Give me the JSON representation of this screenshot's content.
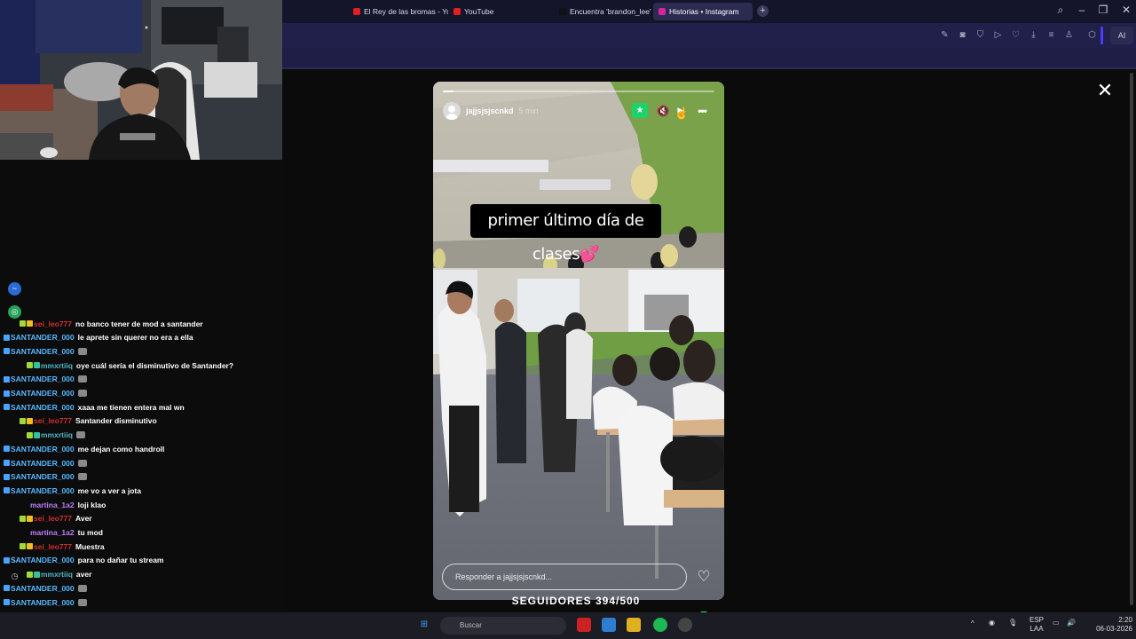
{
  "browser": {
    "tabs": [
      {
        "label": "El Rey de las bromas - Yo",
        "fav": "#e02020",
        "active": false
      },
      {
        "label": "YouTube",
        "fav": "#e02020",
        "active": false
      },
      {
        "label": "Encuentra 'brandon_lee' e",
        "fav": "#111111",
        "active": false
      },
      {
        "label": "Historias • Instagram",
        "fav": "#d6249f",
        "active": true
      }
    ],
    "new_tab_label": "+",
    "ai_label": "AI"
  },
  "story": {
    "username": "jajjsjsjscnkd",
    "time": "5 min",
    "caption": "primer último día de clases💕",
    "reply_placeholder": "Responder a jajjsjsjscnkd...",
    "progress": 0.04
  },
  "chat": {
    "messages": [
      {
        "user": "sei_leo777",
        "color": "#d0312d",
        "badges": [
          "#a2d93a",
          "#f0c020"
        ],
        "text": "no banco tener de mod a santander",
        "emote": false
      },
      {
        "user": "SANTANDER_000",
        "color": "#57b8ff",
        "badges": [
          "#4aa3ff"
        ],
        "text": "le aprete sin querer no era a ella",
        "emote": false
      },
      {
        "user": "SANTANDER_000",
        "color": "#57b8ff",
        "badges": [
          "#4aa3ff"
        ],
        "text": "",
        "emote": true
      },
      {
        "user": "mmxrtiiq",
        "color": "#4fb7c6",
        "badges": [
          "#a2d93a",
          "#35c0a0"
        ],
        "text": "oye cuál sería el disminutivo de Santander?",
        "emote": false
      },
      {
        "user": "SANTANDER_000",
        "color": "#57b8ff",
        "badges": [
          "#4aa3ff"
        ],
        "text": "",
        "emote": true
      },
      {
        "user": "SANTANDER_000",
        "color": "#57b8ff",
        "badges": [
          "#4aa3ff"
        ],
        "text": "",
        "emote": true
      },
      {
        "user": "SANTANDER_000",
        "color": "#57b8ff",
        "badges": [
          "#4aa3ff"
        ],
        "text": "xaaa me tienen entera mal wn",
        "emote": false
      },
      {
        "user": "sei_leo777",
        "color": "#d0312d",
        "badges": [
          "#a2d93a",
          "#f0c020"
        ],
        "text": "Santander disminutivo",
        "emote": false
      },
      {
        "user": "mmxrtiiq",
        "color": "#4fb7c6",
        "badges": [
          "#a2d93a",
          "#35c0a0"
        ],
        "text": "",
        "emote": true
      },
      {
        "user": "SANTANDER_000",
        "color": "#57b8ff",
        "badges": [
          "#4aa3ff"
        ],
        "text": "me dejan como handroll",
        "emote": false
      },
      {
        "user": "SANTANDER_000",
        "color": "#57b8ff",
        "badges": [
          "#4aa3ff"
        ],
        "text": "",
        "emote": true
      },
      {
        "user": "SANTANDER_000",
        "color": "#57b8ff",
        "badges": [
          "#4aa3ff"
        ],
        "text": "",
        "emote": true
      },
      {
        "user": "SANTANDER_000",
        "color": "#57b8ff",
        "badges": [
          "#4aa3ff"
        ],
        "text": "me vo a ver a jota",
        "emote": false
      },
      {
        "user": "martina_1a2",
        "color": "#c07dff",
        "badges": [],
        "text": "loji klao",
        "emote": false
      },
      {
        "user": "sei_leo777",
        "color": "#d0312d",
        "badges": [
          "#a2d93a",
          "#f0c020"
        ],
        "text": "Aver",
        "emote": false
      },
      {
        "user": "martina_1a2",
        "color": "#c07dff",
        "badges": [],
        "text": "tu mod",
        "emote": false
      },
      {
        "user": "sei_leo777",
        "color": "#d0312d",
        "badges": [
          "#a2d93a",
          "#f0c020"
        ],
        "text": "Muestra",
        "emote": false
      },
      {
        "user": "SANTANDER_000",
        "color": "#57b8ff",
        "badges": [
          "#4aa3ff"
        ],
        "text": "para no dañar tu stream",
        "emote": false
      },
      {
        "user": "mmxrtiiq",
        "color": "#4fb7c6",
        "badges": [
          "#a2d93a",
          "#35c0a0"
        ],
        "text": "aver",
        "emote": false
      },
      {
        "user": "SANTANDER_000",
        "color": "#57b8ff",
        "badges": [
          "#4aa3ff"
        ],
        "text": "",
        "emote": true
      },
      {
        "user": "SANTANDER_000",
        "color": "#57b8ff",
        "badges": [
          "#4aa3ff"
        ],
        "text": "",
        "emote": true
      },
      {
        "user": "SANTANDER_000",
        "color": "#57b8ff",
        "badges": [
          "#4aa3ff"
        ],
        "text": "",
        "emote": true
      },
      {
        "user": "SANTANDER_000",
        "color": "#57b8ff",
        "badges": [
          "#4aa3ff"
        ],
        "text": "",
        "emote": true
      }
    ]
  },
  "goal": {
    "label": "SEGUIDORES 394/500",
    "current": 394,
    "target": 500,
    "knob_label": "K",
    "color": "#2cff4c"
  },
  "taskbar": {
    "search_placeholder": "Buscar",
    "lang_top": "ESP",
    "lang_bottom": "LAA",
    "time": "2:20",
    "date": "06-03-2026"
  },
  "colors": {
    "browser_bar": "#14142a",
    "toolbar": "#20204a",
    "accent_green": "#2cff4c",
    "instagram_star": "#1bd26b"
  }
}
